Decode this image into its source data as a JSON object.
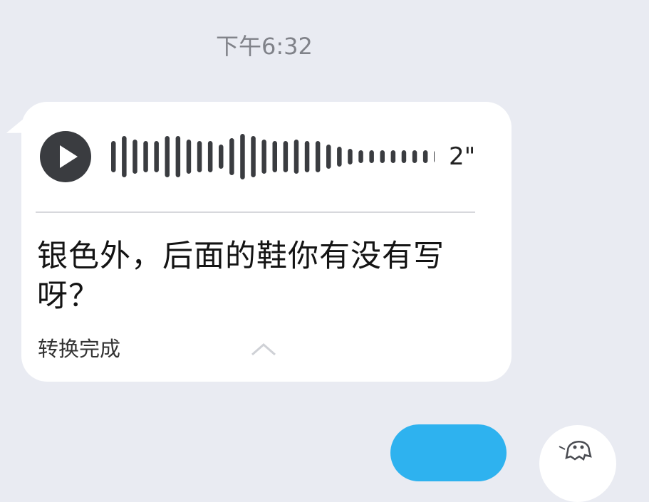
{
  "header": {
    "timestamp": "下午6:32"
  },
  "message": {
    "type": "voice",
    "duration_label": "2\"",
    "transcript": "银色外，后面的鞋你有没有写呀？",
    "status": "转换完成",
    "play_icon": "play-icon",
    "collapse_icon": "chevron-up-icon"
  },
  "chart_data": {
    "type": "bar",
    "values": [
      44,
      58,
      48,
      44,
      44,
      58,
      58,
      48,
      44,
      44,
      34,
      52,
      64,
      58,
      48,
      44,
      44,
      48,
      44,
      44,
      34,
      28,
      22,
      18,
      18,
      18,
      18,
      18,
      18,
      18,
      18,
      18,
      18,
      18,
      18,
      18
    ],
    "ylim": [
      0,
      64
    ]
  },
  "colors": {
    "background": "#e9ebf2",
    "bubble": "#ffffff",
    "waveform": "#3a3c40",
    "accent_blue": "#2eb2ef"
  },
  "footer": {
    "avatar_icon": "ghost-avatar-icon"
  }
}
